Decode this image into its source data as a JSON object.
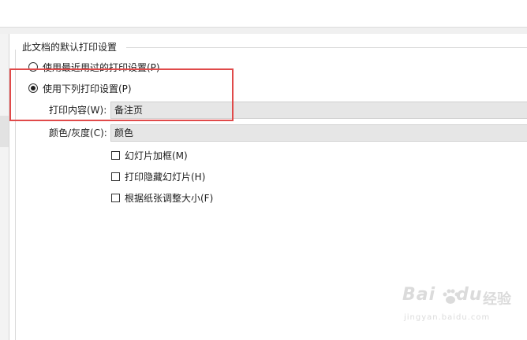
{
  "group": {
    "title": "此文档的默认打印设置",
    "radio_recent": "使用最近用过的打印设置(P)",
    "radio_following": "使用下列打印设置(P)"
  },
  "fields": {
    "content_label": "打印内容(W):",
    "content_value": "备注页",
    "color_label": "颜色/灰度(C):",
    "color_value": "颜色"
  },
  "checkboxes": [
    {
      "label": "幻灯片加框(M)",
      "checked": false
    },
    {
      "label": "打印隐藏幻灯片(H)",
      "checked": false
    },
    {
      "label": "根据纸张调整大小(F)",
      "checked": false
    }
  ],
  "radio_state": {
    "recent": false,
    "following": true
  },
  "annotation": {
    "color": "#e04a4a"
  },
  "watermark": {
    "main": "Bai",
    "suffix": "经验",
    "sub": "jingyan.baidu.com"
  }
}
